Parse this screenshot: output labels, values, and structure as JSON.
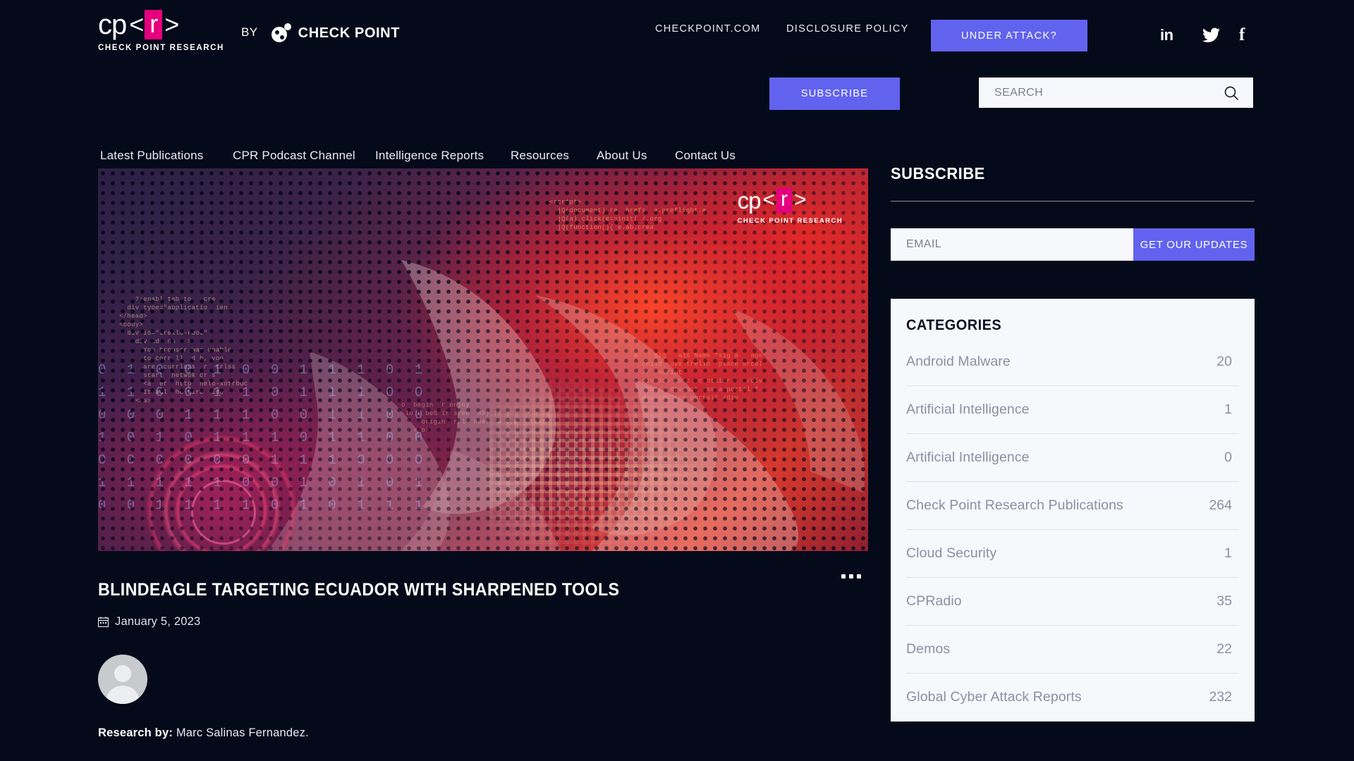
{
  "brand": {
    "cpr_cp": "cp",
    "cpr_lt": "<",
    "cpr_r": "r",
    "cpr_gt": ">",
    "cpr_sub": "CHECK POINT RESEARCH",
    "by": "BY",
    "checkpoint_name": "CHECK POINT",
    "tm": "™"
  },
  "topbar": {
    "links": [
      {
        "label": "CHECKPOINT.COM",
        "name": "checkpoint-com-link"
      },
      {
        "label": "DISCLOSURE POLICY",
        "name": "disclosure-policy-link"
      }
    ],
    "attack_button": "UNDER ATTACK?",
    "socials": [
      {
        "name": "linkedin-icon",
        "glyph": "in"
      },
      {
        "name": "twitter-icon",
        "glyph": "twitter"
      },
      {
        "name": "facebook-icon",
        "glyph": "f"
      }
    ],
    "accent": "#6163ee"
  },
  "nav": {
    "items": [
      {
        "label": "Latest Publications",
        "name": "nav-latest-publications"
      },
      {
        "label": "CPR Podcast Channel",
        "name": "nav-cpr-podcast-channel"
      },
      {
        "label": "Intelligence Reports",
        "name": "nav-intelligence-reports"
      },
      {
        "label": "Resources",
        "name": "nav-resources"
      },
      {
        "label": "About Us",
        "name": "nav-about-us"
      },
      {
        "label": "Contact Us",
        "name": "nav-contact-us"
      }
    ],
    "subscribe_button": "SUBSCRIBE"
  },
  "search": {
    "placeholder": "SEARCH",
    "value": ""
  },
  "article": {
    "title": "BLINDEAGLE TARGETING ECUADOR WITH SHARPENED TOOLS",
    "date": "January 5, 2023",
    "byline_label": "Research by:",
    "byline_author": "Marc Salinas Fernandez.",
    "hero_logo_sub": "CHECK POINT RESEARCH",
    "hero_code_a": "<script>\n  jQ(document).re  hrefs  a.preflight.a\n  jQ(a).click(e=>init( /.org\n  jQ(function(){ e.ab.crea",
    "hero_code_b": "    ?:enabl tab to   cre\n  div type=\"applicatio  ien\n</head>\n<body>\n  div id=\"trello-root\"\n    div id= nn   >\n      You browser was unable\n      to corr ll  d b, you\n      are  currless  r  trlss\n      start  netwok cr s\n      <a  er  http  helo-xofrbUc\n      It abl  he tire  ide\n    </a>",
    "hero_code_c": "o  begin  r enjoy\n lu t beS ir s?ee  a5} (l )=   > u ig\n     origin  r,l  heer  a t,p   text\n   </b>",
    "hero_code_d": "a    sig   als Name \"sig a   age\n  child  use trello  place ercal\n  /r  script\n  div id= ch c  c ntainr    /div\n   This  div act  as a portal f\n  div id=\"ind portal\" /div",
    "hero_binary": "0 1 0 0 1 0 0 1 1 1 0 1\n1 1 0 0 1 1 0 1 1 1 0 0\n0 0 0 1 1 1 0 0 1 1 0 0\n1 0 1 0 1 1 1 0 1 1 0 0\n0 0 0 0 0 0 1 1 1 0 0 0\n1 1 1 1 1 0 0 1 0 1 0 1\n0 0 1 1 1 1 0 1 0 1 1 1",
    "menu_dots": "more-options"
  },
  "sidebar": {
    "subscribe": {
      "title": "SUBSCRIBE",
      "email_placeholder": "EMAIL",
      "email_value": "",
      "button": "GET OUR UPDATES"
    },
    "categories": {
      "title": "CATEGORIES",
      "rows": [
        {
          "label": "Android Malware",
          "count": "20"
        },
        {
          "label": "Artificial Intelligence",
          "count": "1"
        },
        {
          "label": "Artificial Intelligence",
          "count": "0"
        },
        {
          "label": "Check Point Research Publications",
          "count": "264"
        },
        {
          "label": "Cloud Security",
          "count": "1"
        },
        {
          "label": "CPRadio",
          "count": "35"
        },
        {
          "label": "Demos",
          "count": "22"
        },
        {
          "label": "Global Cyber Attack Reports",
          "count": "232"
        }
      ]
    }
  },
  "colors": {
    "page_bg": "#050a1a",
    "accent_purple": "#6163ee",
    "brand_pink": "#e6007e",
    "panel_bg": "#f7f8fc"
  }
}
